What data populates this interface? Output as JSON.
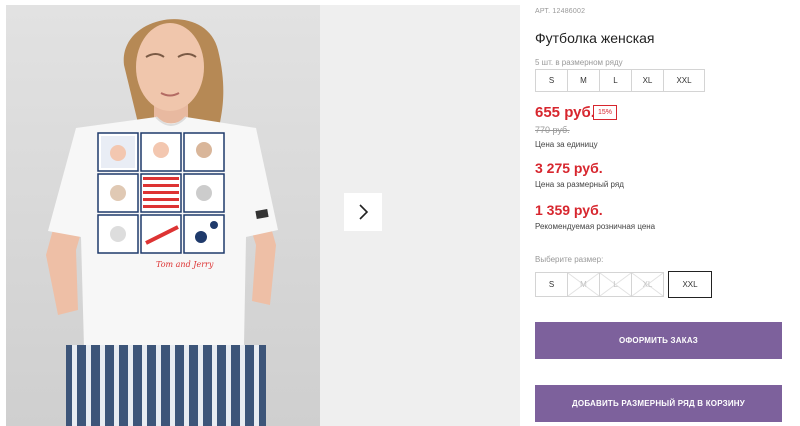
{
  "product": {
    "sku_label": "АРТ. 12486002",
    "title": "Футболка женская",
    "pack_note": "5 шт. в размерном ряду",
    "pack_sizes": [
      "S",
      "M",
      "L",
      "XL",
      "XXL"
    ],
    "price": "655 руб.",
    "discount": "15%",
    "old_price": "770 руб.",
    "unit_note": "Цена за единицу",
    "pack_price": "3 275 руб.",
    "pack_price_note": "Цена за размерный ряд",
    "retail_price": "1 359 руб.",
    "retail_note": "Рекомендуемая розничная цена"
  },
  "size_picker": {
    "label": "Выберите размер:",
    "options": [
      {
        "label": "S",
        "available": true
      },
      {
        "label": "M",
        "available": false
      },
      {
        "label": "L",
        "available": false
      },
      {
        "label": "XL",
        "available": false
      },
      {
        "label": "XXL",
        "available": true,
        "selected": true
      }
    ]
  },
  "buttons": {
    "order": "ОФОРМИТЬ ЗАКАЗ",
    "add_pack": "ДОБАВИТЬ РАЗМЕРНЫЙ РЯД В КОРЗИНУ"
  },
  "print": {
    "brand_text": "Tom and Jerry"
  },
  "colors": {
    "accent": "#7d619c",
    "price": "#d7262e"
  },
  "icons": {
    "next": "chevron-right-icon"
  }
}
